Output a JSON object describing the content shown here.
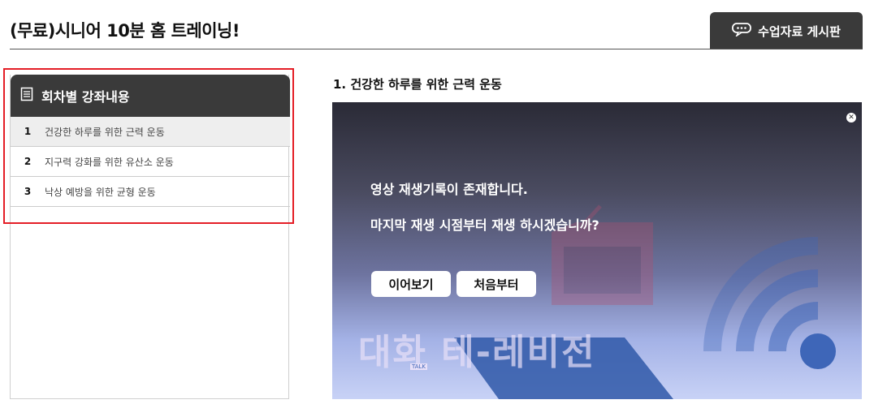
{
  "header": {
    "title": "(무료)시니어 10분 홈 트레이닝!",
    "board_button_label": "수업자료 게시판",
    "board_button_icon": "chat-bubble-icon"
  },
  "sidebar": {
    "title": "회차별 강좌내용",
    "title_icon": "document-list-icon",
    "items": [
      {
        "num": "1",
        "label": "건강한 하루를 위한 근력 운동",
        "active": true
      },
      {
        "num": "2",
        "label": "지구력 강화를 위한 유산소 운동",
        "active": false
      },
      {
        "num": "3",
        "label": "낙상 예방을 위한 균형 운동",
        "active": false
      }
    ]
  },
  "main": {
    "video_title": "1. 건강한 하루를 위한 근력 운동",
    "dialog": {
      "line1": "영상 재생기록이 존재합니다.",
      "line2": "마지막 재생 시점부터 재생 하시겠습니까?",
      "resume_label": "이어보기",
      "restart_label": "처음부터",
      "close_icon": "close-icon"
    },
    "watermark": {
      "brand_text": "대화 테-레비전",
      "small_tag": "TALK"
    }
  },
  "colors": {
    "header_dark": "#3a3a3a",
    "highlight_red": "#e41e26",
    "active_row": "#eeeeee",
    "deco_blue": "#3e66b8"
  }
}
